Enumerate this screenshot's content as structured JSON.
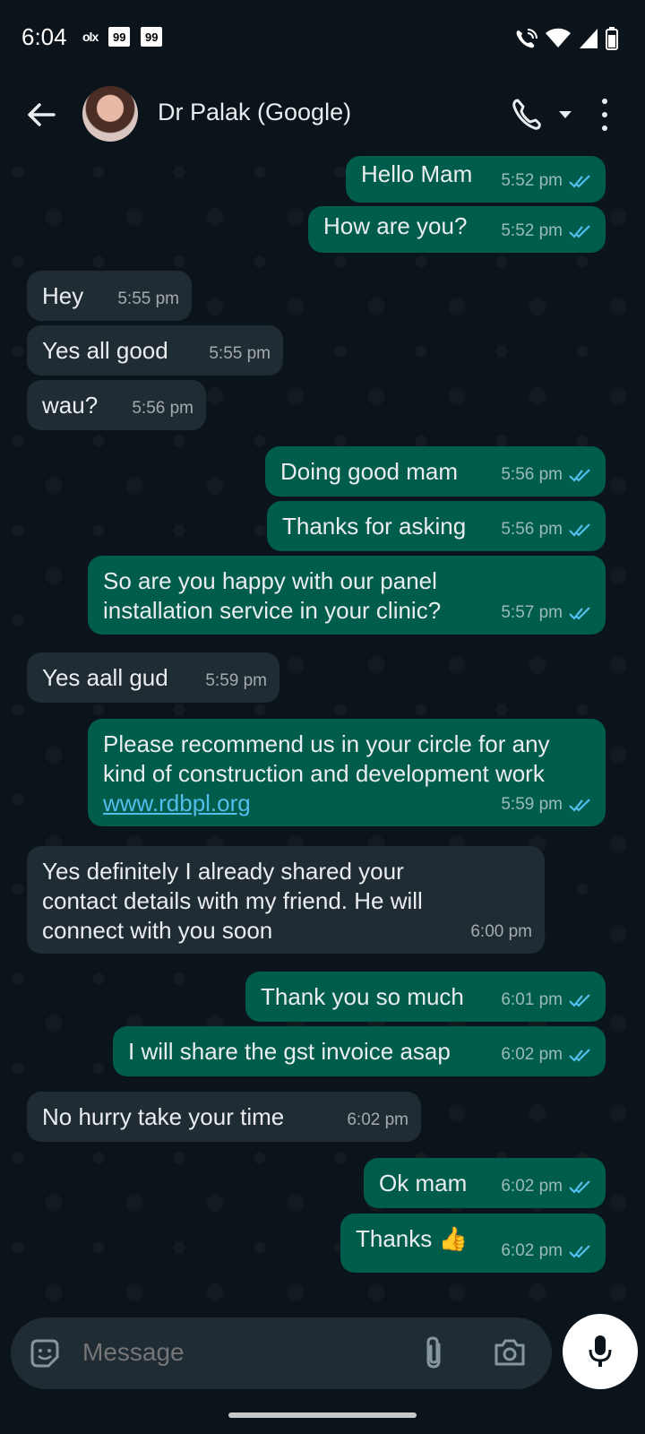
{
  "status": {
    "time": "6:04",
    "icons": [
      "olx-icon",
      "99-icon",
      "99-icon",
      "wifi-call-icon",
      "wifi-icon",
      "signal-icon",
      "battery-icon"
    ],
    "app_badge_1": "99",
    "app_badge_2": "99",
    "olx_label": "olx"
  },
  "header": {
    "contact_name": "Dr Palak (Google)",
    "icons": [
      "back-arrow-icon",
      "avatar",
      "phone-icon",
      "caret-down-icon",
      "more-vert-icon"
    ]
  },
  "messages": [
    {
      "dir": "out",
      "text": "Hello Mam",
      "time": "5:52 pm"
    },
    {
      "dir": "out",
      "text": "How are you?",
      "time": "5:52 pm"
    },
    {
      "dir": "in",
      "text": "Hey",
      "time": "5:55 pm"
    },
    {
      "dir": "in",
      "text": "Yes all good",
      "time": "5:55 pm"
    },
    {
      "dir": "in",
      "text": "wau?",
      "time": "5:56 pm"
    },
    {
      "dir": "out",
      "text": "Doing good mam",
      "time": "5:56 pm"
    },
    {
      "dir": "out",
      "text": "Thanks for asking",
      "time": "5:56 pm"
    },
    {
      "dir": "out",
      "text": "So are you happy with our panel installation service in your clinic?",
      "time": "5:57 pm"
    },
    {
      "dir": "in",
      "text": "Yes aall gud",
      "time": "5:59 pm"
    },
    {
      "dir": "out",
      "text": "Please recommend us in your circle for any kind of construction and development work",
      "link": "www.rdbpl.org",
      "time": "5:59 pm"
    },
    {
      "dir": "in",
      "text": "Yes definitely I already shared your contact details with my friend. He will connect with you soon",
      "time": "6:00 pm"
    },
    {
      "dir": "out",
      "text": "Thank you so much",
      "time": "6:01 pm"
    },
    {
      "dir": "out",
      "text": "I will share the gst invoice asap",
      "time": "6:02 pm"
    },
    {
      "dir": "in",
      "text": "No hurry take your time",
      "time": "6:02 pm"
    },
    {
      "dir": "out",
      "text": "Ok mam",
      "time": "6:02 pm"
    },
    {
      "dir": "out",
      "text": "Thanks 👍",
      "time": "6:02 pm"
    }
  ],
  "input": {
    "placeholder": "Message",
    "value": ""
  },
  "colors": {
    "outgoing_bubble": "#005c4b",
    "incoming_bubble": "#202c33",
    "read_ticks": "#53bdeb",
    "background": "#0b141a"
  }
}
